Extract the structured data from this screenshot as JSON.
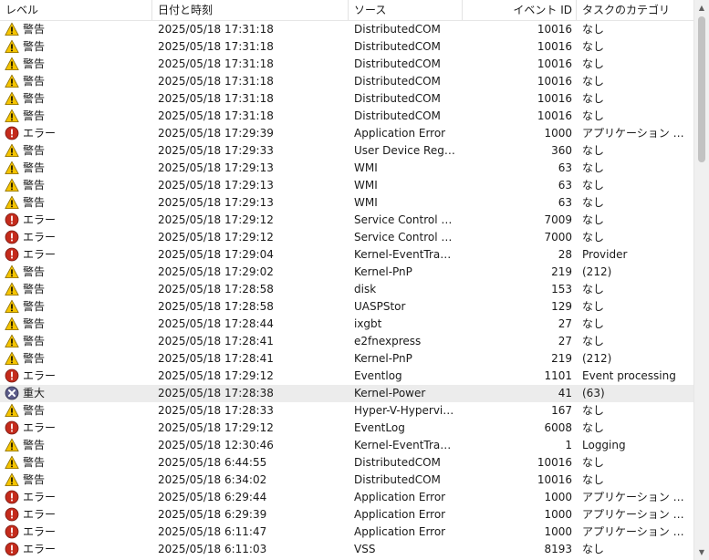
{
  "columns": {
    "level": "レベル",
    "datetime": "日付と時刻",
    "source": "ソース",
    "event_id": "イベント ID",
    "task_category": "タスクのカテゴリ"
  },
  "levels": {
    "warning": {
      "label": "警告",
      "icon": "warning-icon",
      "color": "#f5c400"
    },
    "error": {
      "label": "エラー",
      "icon": "error-icon",
      "color": "#c42b1c"
    },
    "critical": {
      "label": "重大",
      "icon": "critical-icon",
      "color": "#5c5c8a"
    }
  },
  "selected_row_color": "#ececec",
  "rows": [
    {
      "level": "warning",
      "level_label": "警告",
      "datetime": "2025/05/18 17:31:18",
      "source": "DistributedCOM",
      "event_id": "10016",
      "task": "なし"
    },
    {
      "level": "warning",
      "level_label": "警告",
      "datetime": "2025/05/18 17:31:18",
      "source": "DistributedCOM",
      "event_id": "10016",
      "task": "なし"
    },
    {
      "level": "warning",
      "level_label": "警告",
      "datetime": "2025/05/18 17:31:18",
      "source": "DistributedCOM",
      "event_id": "10016",
      "task": "なし"
    },
    {
      "level": "warning",
      "level_label": "警告",
      "datetime": "2025/05/18 17:31:18",
      "source": "DistributedCOM",
      "event_id": "10016",
      "task": "なし"
    },
    {
      "level": "warning",
      "level_label": "警告",
      "datetime": "2025/05/18 17:31:18",
      "source": "DistributedCOM",
      "event_id": "10016",
      "task": "なし"
    },
    {
      "level": "warning",
      "level_label": "警告",
      "datetime": "2025/05/18 17:31:18",
      "source": "DistributedCOM",
      "event_id": "10016",
      "task": "なし"
    },
    {
      "level": "error",
      "level_label": "エラー",
      "datetime": "2025/05/18 17:29:39",
      "source": "Application Error",
      "event_id": "1000",
      "task": "アプリケーション クラッ..."
    },
    {
      "level": "warning",
      "level_label": "警告",
      "datetime": "2025/05/18 17:29:33",
      "source": "User Device Registr...",
      "event_id": "360",
      "task": "なし"
    },
    {
      "level": "warning",
      "level_label": "警告",
      "datetime": "2025/05/18 17:29:13",
      "source": "WMI",
      "event_id": "63",
      "task": "なし"
    },
    {
      "level": "warning",
      "level_label": "警告",
      "datetime": "2025/05/18 17:29:13",
      "source": "WMI",
      "event_id": "63",
      "task": "なし"
    },
    {
      "level": "warning",
      "level_label": "警告",
      "datetime": "2025/05/18 17:29:13",
      "source": "WMI",
      "event_id": "63",
      "task": "なし"
    },
    {
      "level": "error",
      "level_label": "エラー",
      "datetime": "2025/05/18 17:29:12",
      "source": "Service Control Ma...",
      "event_id": "7009",
      "task": "なし"
    },
    {
      "level": "error",
      "level_label": "エラー",
      "datetime": "2025/05/18 17:29:12",
      "source": "Service Control Ma...",
      "event_id": "7000",
      "task": "なし"
    },
    {
      "level": "error",
      "level_label": "エラー",
      "datetime": "2025/05/18 17:29:04",
      "source": "Kernel-EventTracing",
      "event_id": "28",
      "task": "Provider"
    },
    {
      "level": "warning",
      "level_label": "警告",
      "datetime": "2025/05/18 17:29:02",
      "source": "Kernel-PnP",
      "event_id": "219",
      "task": "(212)"
    },
    {
      "level": "warning",
      "level_label": "警告",
      "datetime": "2025/05/18 17:28:58",
      "source": "disk",
      "event_id": "153",
      "task": "なし"
    },
    {
      "level": "warning",
      "level_label": "警告",
      "datetime": "2025/05/18 17:28:58",
      "source": "UASPStor",
      "event_id": "129",
      "task": "なし"
    },
    {
      "level": "warning",
      "level_label": "警告",
      "datetime": "2025/05/18 17:28:44",
      "source": "ixgbt",
      "event_id": "27",
      "task": "なし"
    },
    {
      "level": "warning",
      "level_label": "警告",
      "datetime": "2025/05/18 17:28:41",
      "source": "e2fnexpress",
      "event_id": "27",
      "task": "なし"
    },
    {
      "level": "warning",
      "level_label": "警告",
      "datetime": "2025/05/18 17:28:41",
      "source": "Kernel-PnP",
      "event_id": "219",
      "task": "(212)"
    },
    {
      "level": "error",
      "level_label": "エラー",
      "datetime": "2025/05/18 17:29:12",
      "source": "Eventlog",
      "event_id": "1101",
      "task": "Event processing"
    },
    {
      "level": "critical",
      "level_label": "重大",
      "datetime": "2025/05/18 17:28:38",
      "source": "Kernel-Power",
      "event_id": "41",
      "task": "(63)",
      "selected": true
    },
    {
      "level": "warning",
      "level_label": "警告",
      "datetime": "2025/05/18 17:28:33",
      "source": "Hyper-V-Hypervisor",
      "event_id": "167",
      "task": "なし"
    },
    {
      "level": "error",
      "level_label": "エラー",
      "datetime": "2025/05/18 17:29:12",
      "source": "EventLog",
      "event_id": "6008",
      "task": "なし"
    },
    {
      "level": "warning",
      "level_label": "警告",
      "datetime": "2025/05/18 12:30:46",
      "source": "Kernel-EventTracing",
      "event_id": "1",
      "task": "Logging"
    },
    {
      "level": "warning",
      "level_label": "警告",
      "datetime": "2025/05/18 6:44:55",
      "source": "DistributedCOM",
      "event_id": "10016",
      "task": "なし"
    },
    {
      "level": "warning",
      "level_label": "警告",
      "datetime": "2025/05/18 6:34:02",
      "source": "DistributedCOM",
      "event_id": "10016",
      "task": "なし"
    },
    {
      "level": "error",
      "level_label": "エラー",
      "datetime": "2025/05/18 6:29:44",
      "source": "Application Error",
      "event_id": "1000",
      "task": "アプリケーション クラッ..."
    },
    {
      "level": "error",
      "level_label": "エラー",
      "datetime": "2025/05/18 6:29:39",
      "source": "Application Error",
      "event_id": "1000",
      "task": "アプリケーション クラッ..."
    },
    {
      "level": "error",
      "level_label": "エラー",
      "datetime": "2025/05/18 6:11:47",
      "source": "Application Error",
      "event_id": "1000",
      "task": "アプリケーション クラッ..."
    },
    {
      "level": "error",
      "level_label": "エラー",
      "datetime": "2025/05/18 6:11:03",
      "source": "VSS",
      "event_id": "8193",
      "task": "なし"
    }
  ]
}
